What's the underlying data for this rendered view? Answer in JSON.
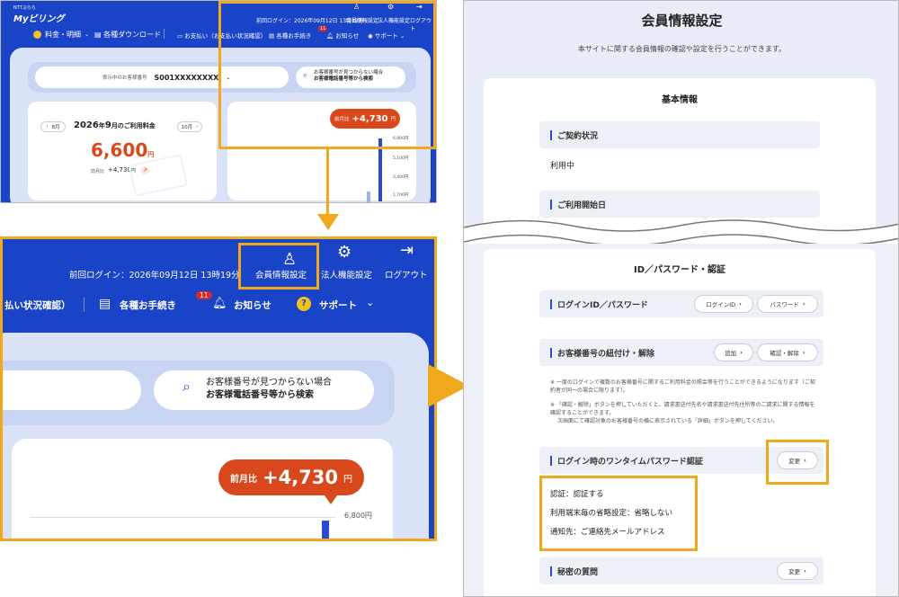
{
  "shot1": {
    "logo_top": "NTTぷらら",
    "logo": "Myビリング",
    "last_login": "前回ログイン：2026年09月12日 13時19分",
    "top_links": [
      "会員情報設定",
      "法人機能設定",
      "ログアウト"
    ],
    "nav": [
      "料金・明細",
      "各種ダウンロード",
      "お支払い（お支払い状況確認）",
      "各種お手続き",
      "お知らせ",
      "サポート"
    ],
    "notice_count": "11",
    "customer_label": "表示中のお客様番号",
    "customer_number": "S001XXXXXXXX",
    "search_line1": "お客様番号が見つからない場合",
    "search_line2": "お客様電話番号等から検索",
    "prev_month": "8月",
    "next_month": "10月",
    "title_year": "2026",
    "title_year_suffix": "年",
    "title_month": "9",
    "title_rest": "月のご利用料金",
    "amount": "6,600",
    "amount_unit": "円",
    "diff_label": "前月比",
    "diff_value": "+4,730",
    "diff_unit": "円",
    "bubble_label": "前月比",
    "bubble_value": "+4,730",
    "bubble_unit": "円",
    "ticks": [
      "6,800円",
      "5,100円",
      "3,400円",
      "1,700円"
    ]
  },
  "shot2": {
    "last_login": "前回ログイン：2026年09月12日 13時19分",
    "top_links": [
      "会員情報設定",
      "法人機能設定",
      "ログアウト"
    ],
    "nav_partial": "払い状況確認）",
    "nav": [
      "各種お手続き",
      "お知らせ",
      "サポート"
    ],
    "notice_count": "11",
    "search_line1": "お客様番号が見つからない場合",
    "search_line2": "お客様電話番号等から検索",
    "bubble_label": "前月比",
    "bubble_value": "+4,730",
    "bubble_unit": "円",
    "tick": "6,800円"
  },
  "panel": {
    "title": "会員情報設定",
    "subtitle": "本サイトに関する会員情報の確認や設定を行うことができます。",
    "basic_heading": "基本情報",
    "contract_label": "ご契約状況",
    "contract_value": "利用中",
    "start_label": "ご利用開始日",
    "id_heading": "ID／パスワード・認証",
    "login_label": "ログインID／パスワード",
    "btn_login_id": "ログインID",
    "btn_password": "パスワード",
    "link_label": "お客様番号の紐付け・解除",
    "btn_add": "追加",
    "btn_confirm": "確認・解除",
    "note1": "※ 一度のログインで複数のお客様番号に関するご利用料金の照会等を行うことができるようになります（ご契約者が同一の場合に限ります）。",
    "note2a": "※ 「確認・解除」ボタンを押していただくと、請求書送付先名や請求書送付先住所等のご請求に関する情報を確認することができます。",
    "note2b": "次画面にて確認対象のお客様番号の横に表示されている「詳細」ボタンを押してください。",
    "otp_label": "ログイン時のワンタイムパスワード認証",
    "btn_change": "変更",
    "otp_lines": [
      "認証：認証する",
      "利用端末毎の省略設定：省略しない",
      "通知先：ご連絡先メールアドレス"
    ],
    "secret_label": "秘密の質問",
    "btn_change2": "変更"
  },
  "colors": {
    "brand_blue": "#1a44c8",
    "highlight": "#f0a81d",
    "bubble": "#d9481c"
  }
}
